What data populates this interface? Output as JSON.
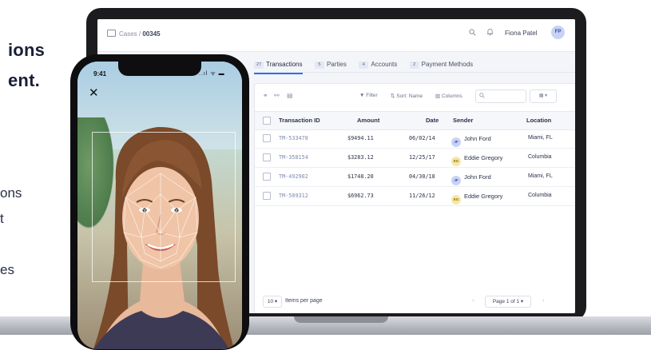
{
  "background": {
    "heading_line1": "ions",
    "heading_line2": "ent.",
    "para_line1": "ons",
    "para_line2": "t",
    "para_line3": "es"
  },
  "header": {
    "breadcrumb_parent": "Cases",
    "breadcrumb_sep": " / ",
    "breadcrumb_case": "00345",
    "user_name": "Fiona Patel",
    "user_initials": "FP"
  },
  "tabs": [
    {
      "count": "27",
      "label": "Transactions",
      "active": true
    },
    {
      "count": "5",
      "label": "Parties"
    },
    {
      "count": "4",
      "label": "Accounts"
    },
    {
      "count": "2",
      "label": "Payment Methods"
    }
  ],
  "toolbar": {
    "filter_label": "Filter",
    "sort_label": "Sort: Name",
    "columns_label": "Columns",
    "search_placeholder": "",
    "view_label": "▦ ▾"
  },
  "table": {
    "columns": [
      "Transaction ID",
      "Amount",
      "Date",
      "Sender",
      "Location"
    ],
    "rows": [
      {
        "id": "TM-533478",
        "amount": "$9494.11",
        "date": "06/02/14",
        "sender_initials": "JF",
        "sender": "John Ford",
        "location": "Miami, FL"
      },
      {
        "id": "TM-358154",
        "amount": "$3283.12",
        "date": "12/25/17",
        "sender_initials": "EG",
        "sender": "Eddie Gregory",
        "location": "Columbia"
      },
      {
        "id": "TM-492902",
        "amount": "$1748.20",
        "date": "04/30/18",
        "sender_initials": "JF",
        "sender": "John Ford",
        "location": "Miami, FL"
      },
      {
        "id": "TM-509312",
        "amount": "$6962.73",
        "date": "11/26/12",
        "sender_initials": "EG",
        "sender": "Eddie Gregory",
        "location": "Columbia"
      }
    ]
  },
  "footer": {
    "per_page_value": "10 ▾",
    "per_page_label": "Items per page",
    "page_label": "Page 1 of 1 ▾",
    "prev": "‹",
    "next": "›"
  },
  "phone": {
    "time": "9:41",
    "status": "..ıl ᯤ ▬",
    "close": "✕"
  },
  "colors": {
    "accent": "#2f6fec",
    "jf_avatar": "#c9d2f6",
    "eg_avatar": "#f7e7a6"
  }
}
